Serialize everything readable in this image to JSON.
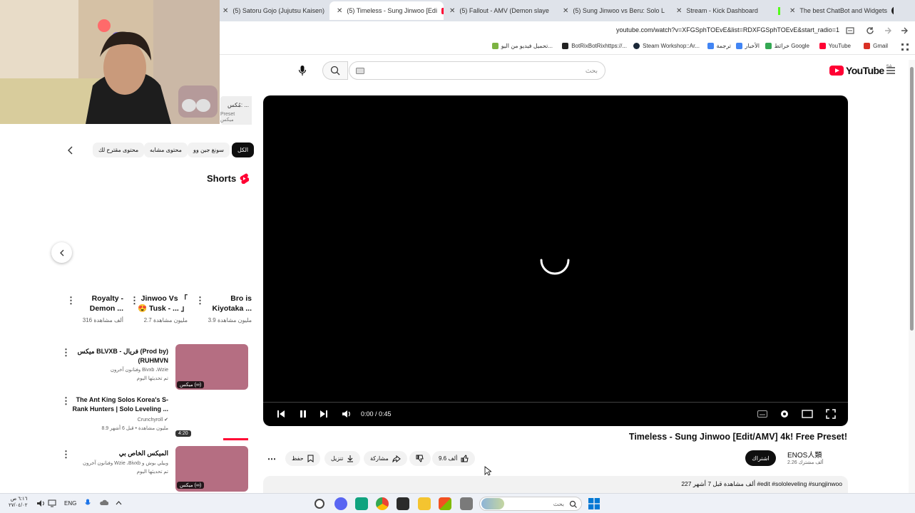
{
  "tabs": [
    {
      "label": "(5) Satoru Gojo (Jujutsu Kaisen)",
      "favicon": "youtube-icon",
      "active": false
    },
    {
      "label": "(5) Timeless - Sung Jinwoo [Edi",
      "favicon": "youtube-icon",
      "active": true
    },
    {
      "label": "(5) Fallout - AMV (Demon slaye",
      "favicon": "youtube-icon",
      "active": false
    },
    {
      "label": "(5) Sung Jinwoo vs Beru: Solo L",
      "favicon": "youtube-icon",
      "active": false
    },
    {
      "label": "Stream - Kick Dashboard",
      "favicon": "kick-icon",
      "active": false
    },
    {
      "label": "The best ChatBot and Widgets",
      "favicon": "github-icon",
      "active": false
    }
  ],
  "address_bar": {
    "url": "youtube.com/watch?v=XFGSphTOEvE&list=RDXFGSphTOEvE&start_radio=1"
  },
  "bookmarks": [
    {
      "label": "Gmail",
      "icon": "gmail-icon",
      "color": "#d93025"
    },
    {
      "label": "YouTube",
      "icon": "youtube-icon",
      "color": "#ff0033"
    },
    {
      "label": "خرائط Google",
      "icon": "maps-icon",
      "color": "#34a853"
    },
    {
      "label": "الأخبار",
      "icon": "news-icon",
      "color": "#4285f4"
    },
    {
      "label": "ترجمة",
      "icon": "translate-icon",
      "color": "#4285f4"
    },
    {
      "label": "Steam Workshop::Ar...",
      "icon": "steam-icon",
      "color": "#1b2838"
    },
    {
      "label": "BotRixBotRixhttps://...",
      "icon": "botrix-icon",
      "color": "#222222"
    },
    {
      "label": "تحميل فيديو من اليو...",
      "icon": "download-icon",
      "color": "#7cb342"
    }
  ],
  "youtube": {
    "logo_text": "YouTube",
    "logo_region": "SA",
    "search_placeholder": "بحث",
    "brand_color": "#ff0033"
  },
  "player": {
    "time": "0:00 / 0:45",
    "state": "loading"
  },
  "video": {
    "title": "Timeless - Sung Jinwoo [Edit/AMV] 4k! Free Preset!",
    "channel": "ENOS人類",
    "subscribers": "2.26 ألف مشترك",
    "subscribe_label": "اشتراك",
    "likes": "9.6 ألف",
    "share_label": "مشاركة",
    "download_label": "تنزيل",
    "save_label": "حفظ",
    "description_line": "227 ألف مشاهدة قبل 7 أشهر #edit #sololeveling #sungjinwoo"
  },
  "sidebar": {
    "playlist_peek": {
      "line1": "مُكس: ...",
      "line2": "Preset ميكس"
    },
    "chips": [
      {
        "label": "الكل",
        "active": true
      },
      {
        "label": "سونغ جين وو",
        "active": false
      },
      {
        "label": "محتوى مشابه",
        "active": false
      },
      {
        "label": "محتوى مقترح لك",
        "active": false
      }
    ],
    "shorts_title": "Shorts",
    "shorts": [
      {
        "title": "Bro is Kiyotaka ...",
        "views": "3.9 مليون مشاهدة"
      },
      {
        "title": "Jinwoo Vs 「 😍 Tusk - ... 」",
        "views": "2.7 مليون مشاهدة"
      },
      {
        "title": "Royalty - Demon ...",
        "views": "316 ألف مشاهدة"
      }
    ],
    "videos": [
      {
        "title": "ميكس BLVXB - فريال (Prod by) (RUHMVN",
        "meta1": "وفنانون آخرون Bivxb ،Wzie",
        "meta2": "تم تحديثها اليوم",
        "badge": "ميكس (∞)"
      },
      {
        "title": "The Ant King Solos Korea's S-Rank Hunters | Solo Leveling ...",
        "meta1": "Crunchyroll ✔",
        "meta2": "8.9 مليون مشاهدة • قبل 6 أشهر",
        "badge": "4:20"
      },
      {
        "title": "الميكس الخاص بي",
        "meta1": "وفنانون آخرون Wzie ،Bivxb وبيلي بوش و",
        "meta2": "تم تحديثها اليوم",
        "badge": "ميكس (∞)"
      }
    ]
  },
  "taskbar": {
    "language": "ENG",
    "search_placeholder": "بحث",
    "time": "٦:١٦ ص",
    "date": "٢٧/٠٤/٠٢"
  }
}
